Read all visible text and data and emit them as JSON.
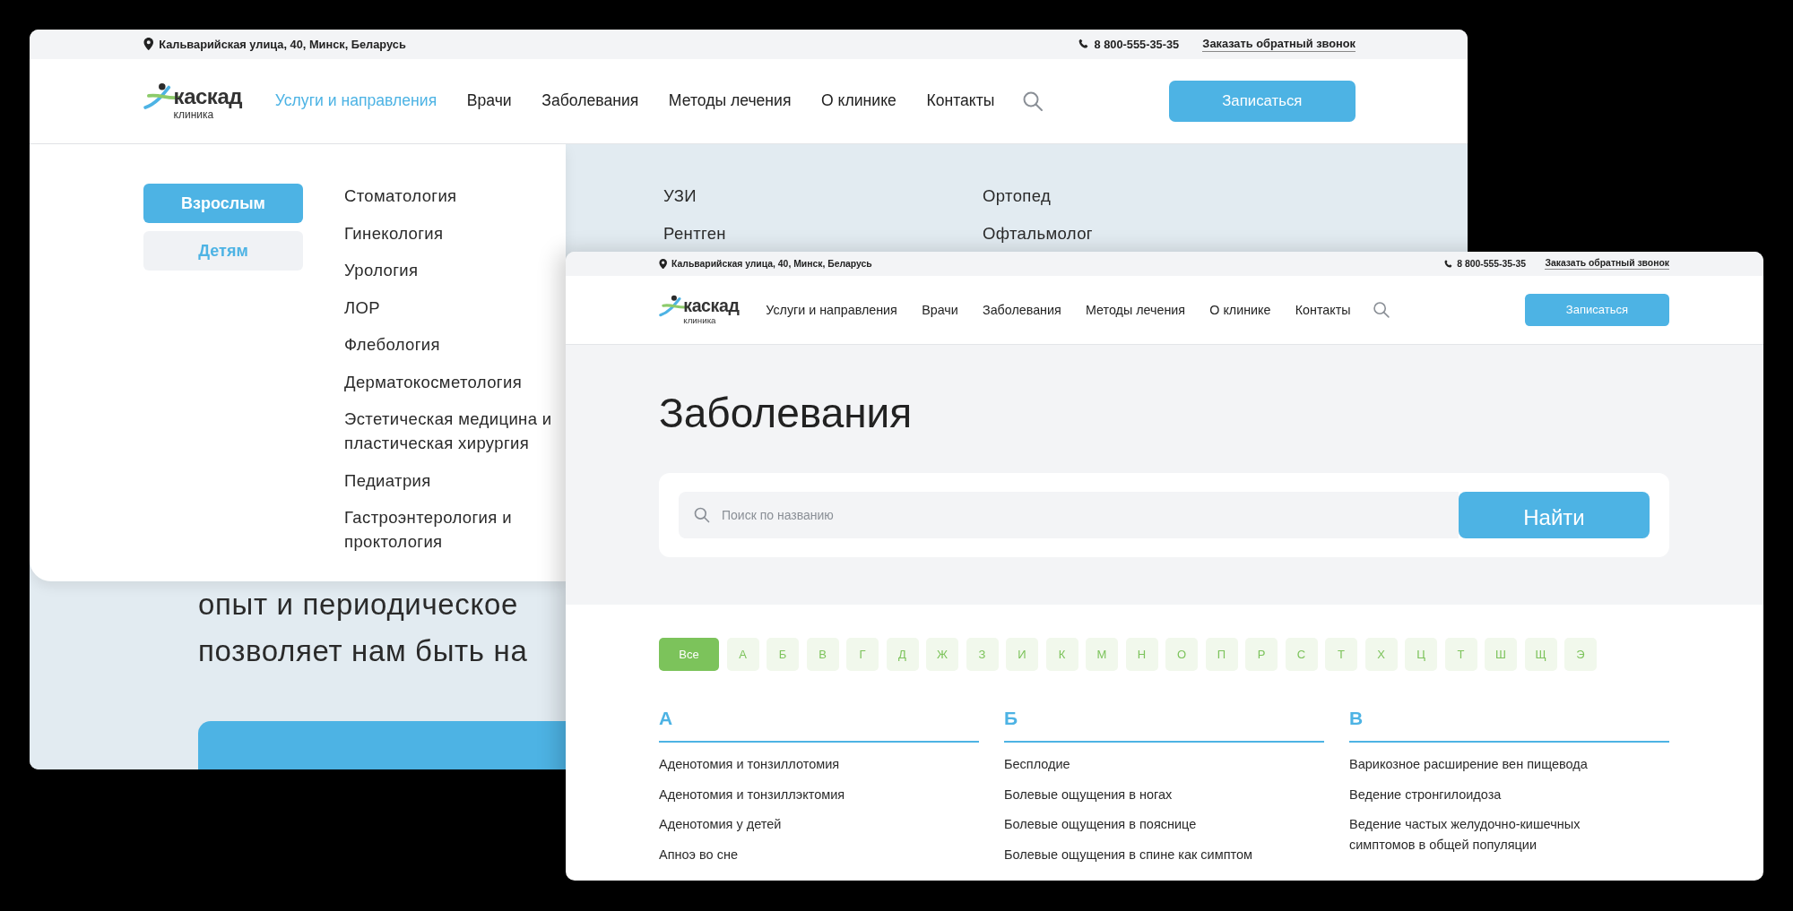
{
  "back_page": {
    "top_bar": {
      "address": "Кальварийская улица, 40, Минск, Беларусь",
      "phone": "8 800-555-35-35",
      "callback_link": "Заказать обратный звонок"
    },
    "logo": {
      "name": "каскад",
      "subtitle": "клиника"
    },
    "nav": [
      {
        "label": "Услуги и направления",
        "selected": true
      },
      {
        "label": "Врачи",
        "selected": false
      },
      {
        "label": "Заболевания",
        "selected": false
      },
      {
        "label": "Методы лечения",
        "selected": false
      },
      {
        "label": "О клинике",
        "selected": false
      },
      {
        "label": "Контакты",
        "selected": false
      }
    ],
    "signup_button": "Записаться",
    "mega_menu": {
      "audience_tabs": [
        {
          "label": "Взрослым",
          "selected": true
        },
        {
          "label": "Детям",
          "selected": false
        }
      ],
      "columns": [
        [
          "Стоматология",
          "Гинекология",
          "Урология",
          "ЛОР",
          "Флебология",
          "Дерматокосметология",
          "Эстетическая медицина и пластическая хирургия",
          "Педиатрия",
          "Гастроэнтерология и проктология"
        ],
        [
          "УЗИ",
          "Рентген"
        ],
        [
          "Ортопед",
          "Офтальмолог"
        ]
      ]
    },
    "hero": {
      "lines": [
        "опыт и периодическое",
        "позволяет нам быть на"
      ]
    }
  },
  "front_page": {
    "top_bar": {
      "address": "Кальварийская улица, 40, Минск, Беларусь",
      "phone": "8 800-555-35-35",
      "callback_link": "Заказать обратный звонок"
    },
    "logo": {
      "name": "каскад",
      "subtitle": "клиника"
    },
    "nav": [
      {
        "label": "Услуги и направления",
        "selected": false
      },
      {
        "label": "Врачи",
        "selected": false
      },
      {
        "label": "Заболевания",
        "selected": false
      },
      {
        "label": "Методы лечения",
        "selected": false
      },
      {
        "label": "О клинике",
        "selected": false
      },
      {
        "label": "Контакты",
        "selected": false
      }
    ],
    "signup_button": "Записаться",
    "title": "Заболевания",
    "search": {
      "placeholder": "Поиск по названию",
      "button": "Найти"
    },
    "alphabet": [
      {
        "label": "Все",
        "selected": true
      },
      {
        "label": "А",
        "selected": false
      },
      {
        "label": "Б",
        "selected": false
      },
      {
        "label": "В",
        "selected": false
      },
      {
        "label": "Г",
        "selected": false
      },
      {
        "label": "Д",
        "selected": false
      },
      {
        "label": "Ж",
        "selected": false
      },
      {
        "label": "З",
        "selected": false
      },
      {
        "label": "И",
        "selected": false
      },
      {
        "label": "К",
        "selected": false
      },
      {
        "label": "М",
        "selected": false
      },
      {
        "label": "Н",
        "selected": false
      },
      {
        "label": "О",
        "selected": false
      },
      {
        "label": "П",
        "selected": false
      },
      {
        "label": "Р",
        "selected": false
      },
      {
        "label": "С",
        "selected": false
      },
      {
        "label": "Т",
        "selected": false
      },
      {
        "label": "Х",
        "selected": false
      },
      {
        "label": "Ц",
        "selected": false
      },
      {
        "label": "Т",
        "selected": false
      },
      {
        "label": "Ш",
        "selected": false
      },
      {
        "label": "Щ",
        "selected": false
      },
      {
        "label": "Э",
        "selected": false
      }
    ],
    "sections": [
      {
        "letter": "А",
        "items": [
          "Аденотомия и тонзиллотомия",
          "Аденотомия и тонзиллэктомия",
          "Аденотомия у детей",
          "Апноэ во сне"
        ]
      },
      {
        "letter": "Б",
        "items": [
          "Бесплодие",
          "Болевые ощущения в ногах",
          "Болевые ощущения в пояснице",
          "Болевые ощущения в спине как симптом"
        ]
      },
      {
        "letter": "В",
        "items": [
          "Варикозное расширение вен пищевода",
          "Ведение стронгилоидоза",
          "Ведение частых желудочно-кишечных симптомов в общей популяции"
        ]
      }
    ]
  }
}
